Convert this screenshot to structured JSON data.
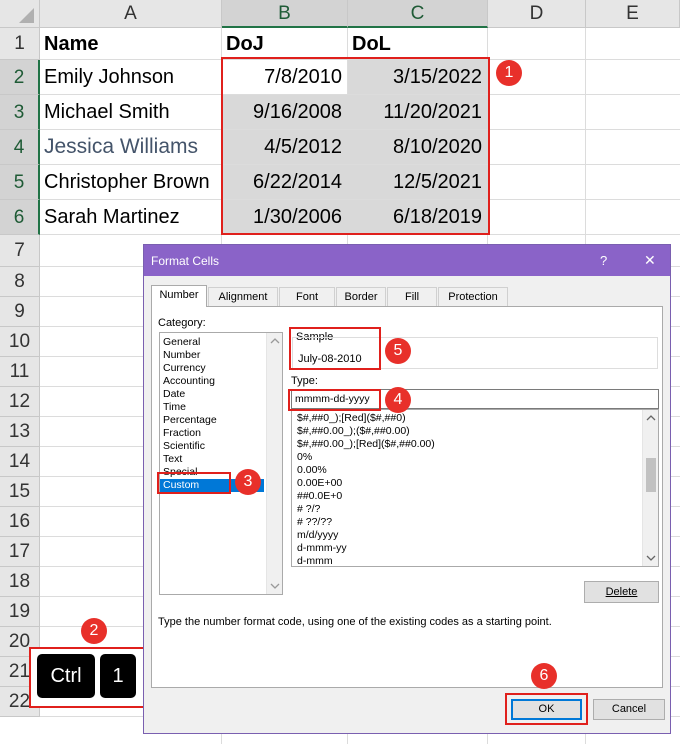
{
  "sheet": {
    "columns": [
      "A",
      "B",
      "C",
      "D",
      "E"
    ],
    "rows": [
      "1",
      "2",
      "3",
      "4",
      "5",
      "6",
      "7",
      "8",
      "9",
      "10",
      "11",
      "12",
      "13",
      "14",
      "15",
      "16",
      "17",
      "18",
      "19",
      "20",
      "21",
      "22"
    ],
    "headers": {
      "a": "Name",
      "b": "DoJ",
      "c": "DoL"
    },
    "data": [
      {
        "name": "Emily Johnson",
        "doj": "7/8/2010",
        "dol": "3/15/2022"
      },
      {
        "name": "Michael Smith",
        "doj": "9/16/2008",
        "dol": "11/20/2021"
      },
      {
        "name": "Jessica Williams",
        "doj": "4/5/2012",
        "dol": "8/10/2020"
      },
      {
        "name": "Christopher Brown",
        "doj": "6/22/2014",
        "dol": "12/5/2021"
      },
      {
        "name": "Sarah Martinez",
        "doj": "1/30/2006",
        "dol": "6/18/2019"
      }
    ]
  },
  "dialog": {
    "title": "Format Cells",
    "help": "?",
    "close": "✕",
    "tabs": [
      "Number",
      "Alignment",
      "Font",
      "Border",
      "Fill",
      "Protection"
    ],
    "category_label": "Category:",
    "categories": [
      "General",
      "Number",
      "Currency",
      "Accounting",
      "Date",
      "Time",
      "Percentage",
      "Fraction",
      "Scientific",
      "Text",
      "Special",
      "Custom"
    ],
    "sample_label": "Sample",
    "sample_value": "July-08-2010",
    "type_label": "Type:",
    "type_value": "mmmm-dd-yyyy",
    "format_list": [
      "$#,##0_);[Red]($#,##0)",
      "$#,##0.00_);($#,##0.00)",
      "$#,##0.00_);[Red]($#,##0.00)",
      "0%",
      "0.00%",
      "0.00E+00",
      "##0.0E+0",
      "# ?/?",
      "# ??/??",
      "m/d/yyyy",
      "d-mmm-yy",
      "d-mmm"
    ],
    "delete_label": "Delete",
    "hint": "Type the number format code, using one of the existing codes as a starting point.",
    "ok_label": "OK",
    "cancel_label": "Cancel"
  },
  "keys": {
    "ctrl": "Ctrl",
    "one": "1"
  },
  "badges": [
    "1",
    "2",
    "3",
    "4",
    "5",
    "6"
  ],
  "colors": {
    "annotation_red": "#e0201c",
    "dialog_title": "#8a63c8",
    "selection": "#0078d7",
    "excel_green": "#217346"
  }
}
